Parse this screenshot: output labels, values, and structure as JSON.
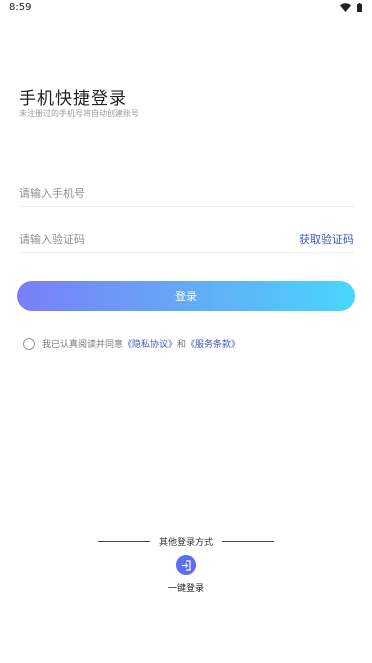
{
  "status_bar": {
    "time": "8:59"
  },
  "header": {
    "title": "手机快捷登录",
    "subtitle": "未注册过的手机号将自动创建账号"
  },
  "form": {
    "phone_placeholder": "请输入手机号",
    "code_placeholder": "请输入验证码",
    "get_code_label": "获取验证码",
    "login_label": "登录"
  },
  "agreement": {
    "prefix": "我已认真阅读并同意",
    "privacy_link": "《隐私协议》",
    "and": "和",
    "terms_link": "《服务条款》"
  },
  "other_login": {
    "label": "其他登录方式",
    "one_click_label": "一键登录"
  },
  "colors": {
    "accent": "#3d57c9",
    "button_gradient_start": "#7a7ef8",
    "button_gradient_end": "#48d6fb",
    "one_click_icon_bg": "#5b6df0"
  }
}
